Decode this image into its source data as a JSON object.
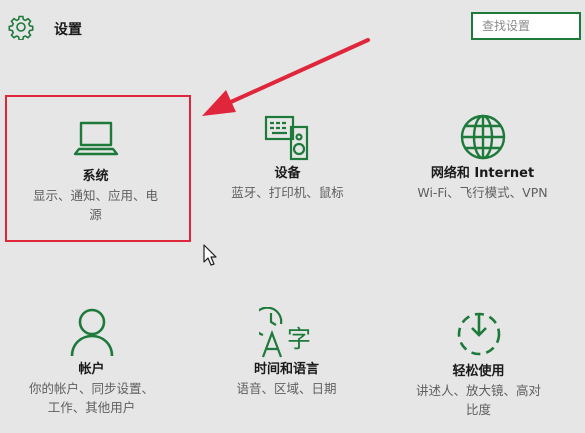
{
  "header": {
    "title": "设置",
    "search_placeholder": "查找设置"
  },
  "tiles": [
    {
      "label": "系统",
      "desc_line1": "显示、通知、应用、电",
      "desc_line2": "源",
      "icon": "laptop-icon"
    },
    {
      "label": "设备",
      "desc_line1": "蓝牙、打印机、鼠标",
      "desc_line2": "",
      "icon": "devices-icon"
    },
    {
      "label": "网络和 Internet",
      "desc_line1": "Wi-Fi、飞行模式、VPN",
      "desc_line2": "",
      "icon": "globe-icon"
    },
    {
      "label": "帐户",
      "desc_line1": "你的帐户、同步设置、",
      "desc_line2": "工作、其他用户",
      "icon": "person-icon"
    },
    {
      "label": "时间和语言",
      "desc_line1": "语音、区域、日期",
      "desc_line2": "",
      "icon": "time-language-icon"
    },
    {
      "label": "轻松使用",
      "desc_line1": "讲述人、放大镜、高对",
      "desc_line2": "比度",
      "icon": "ease-of-access-icon"
    }
  ],
  "colors": {
    "accent": "#1d7a3a",
    "highlight": "#e0263a",
    "background": "#e6e6e6"
  }
}
